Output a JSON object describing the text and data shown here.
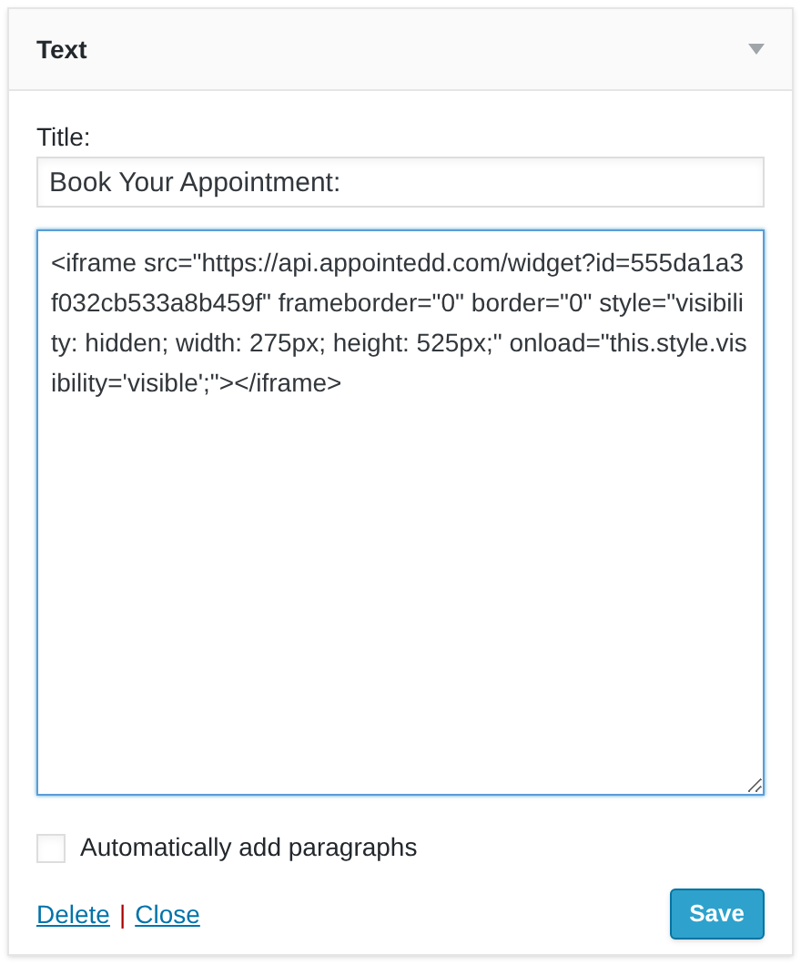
{
  "widget": {
    "title": "Text",
    "expanded": true
  },
  "title_field": {
    "label": "Title:",
    "value": "Book Your Appointment:"
  },
  "content_field": {
    "value": "<iframe src=\"https://api.appointedd.com/widget?id=555da1a3f032cb533a8b459f\" frameborder=\"0\" border=\"0\" style=\"visibility: hidden; width: 275px; height: 525px;\" onload=\"this.style.visibility='visible';\"></iframe>"
  },
  "auto_paragraphs": {
    "label": "Automatically add paragraphs",
    "checked": false
  },
  "links": [
    {
      "label": "Delete"
    },
    {
      "label": "Close"
    }
  ],
  "separator": "|",
  "save_button": {
    "label": "Save"
  }
}
